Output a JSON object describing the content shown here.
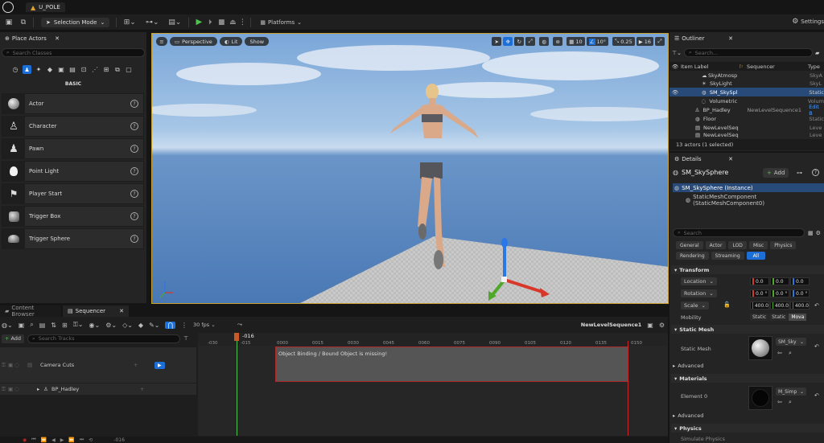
{
  "titlebar": {
    "project_tab": "U_POLE"
  },
  "toolbar": {
    "selection_mode": "Selection Mode",
    "platforms": "Platforms",
    "settings": "Settings"
  },
  "place_actors": {
    "tab": "Place Actors",
    "search_placeholder": "Search Classes",
    "category": "BASIC",
    "items": [
      {
        "label": "Actor",
        "icon": "sphere-icon"
      },
      {
        "label": "Character",
        "icon": "character-icon"
      },
      {
        "label": "Pawn",
        "icon": "pawn-icon"
      },
      {
        "label": "Point Light",
        "icon": "lightbulb-icon"
      },
      {
        "label": "Player Start",
        "icon": "flag-icon"
      },
      {
        "label": "Trigger Box",
        "icon": "box-icon"
      },
      {
        "label": "Trigger Sphere",
        "icon": "sphere-icon"
      }
    ],
    "help": "?"
  },
  "viewport": {
    "perspective": "Perspective",
    "lit": "Lit",
    "show": "Show",
    "grid_snap": "10",
    "rot_snap": "10°",
    "scale_snap": "0.25",
    "cam_speed": "16"
  },
  "outliner": {
    "tab": "Outliner",
    "search_placeholder": "Search...",
    "col_label": "Item Label",
    "col_sequencer": "Sequencer",
    "col_type": "Type",
    "rows": [
      {
        "label": "SkyAtmosp",
        "seq": "",
        "type": "SkyA"
      },
      {
        "label": "SkyLight",
        "seq": "",
        "type": "SkyL"
      },
      {
        "label": "SM_SkySpl",
        "seq": "",
        "type": "Static"
      },
      {
        "label": "Volumetric",
        "seq": "",
        "type": "Volum"
      },
      {
        "label": "BP_Hadley",
        "seq": "NewLevelSequence1",
        "type": "Edit B"
      },
      {
        "label": "Floor",
        "seq": "",
        "type": "Static"
      },
      {
        "label": "NewLevelSeq",
        "seq": "",
        "type": "Leve"
      },
      {
        "label": "NewLevelSeq",
        "seq": "",
        "type": "Leve"
      }
    ],
    "status": "13 actors (1 selected)"
  },
  "details": {
    "tab": "Details",
    "object_name": "SM_SkySphere",
    "add_label": "Add",
    "instance": "SM_SkySphere (Instance)",
    "component": "StaticMeshComponent (StaticMeshComponent0)",
    "search_placeholder": "Search",
    "tabs": [
      "General",
      "Actor",
      "LOD",
      "Misc",
      "Physics",
      "Rendering",
      "Streaming",
      "All"
    ],
    "transform": {
      "header": "Transform",
      "location_label": "Location",
      "rotation_label": "Rotation",
      "scale_label": "Scale",
      "location": [
        "0.0",
        "0.0",
        "0.0"
      ],
      "rotation": [
        "0.0 °",
        "0.0 °",
        "0.0 °"
      ],
      "scale": [
        "400.0",
        "400.0",
        "400.0"
      ],
      "mobility_label": "Mobility",
      "mobility_options": [
        "Static",
        "Static",
        "Mova"
      ]
    },
    "static_mesh": {
      "header": "Static Mesh",
      "label": "Static Mesh",
      "value": "SM_Sky",
      "advanced": "Advanced"
    },
    "materials": {
      "header": "Materials",
      "label": "Element 0",
      "value": "M_Simp",
      "advanced": "Advanced"
    },
    "physics": {
      "header": "Physics",
      "row": "Simulate Physics"
    }
  },
  "bottom_tabs": {
    "content_browser": "Content Browser",
    "sequencer": "Sequencer"
  },
  "sequencer": {
    "fps": "30 fps",
    "sequence_name": "NewLevelSequence1",
    "add_label": "Add",
    "search_placeholder": "Search Tracks",
    "playhead": "-016",
    "ticks": [
      "-030",
      "-015",
      "0000",
      "0015",
      "0030",
      "0045",
      "0060",
      "0075",
      "0090",
      "0105",
      "0120",
      "0135",
      "0150"
    ],
    "tracks": [
      "Camera Cuts",
      "BP_Hadley"
    ],
    "warning": "Object Binding / Bound Object is missing!",
    "bottom_frame": "-016"
  }
}
